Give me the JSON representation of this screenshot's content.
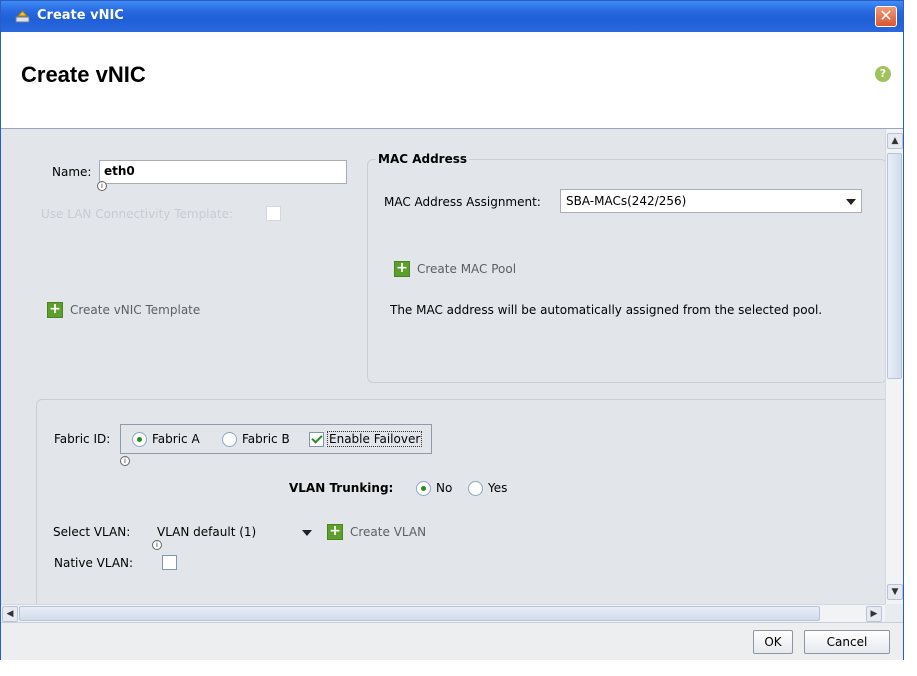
{
  "window": {
    "title": "Create vNIC"
  },
  "header": {
    "title": "Create vNIC",
    "help_symbol": "?"
  },
  "left": {
    "name_label": "Name:",
    "name_value": "eth0",
    "lan_template_label": "Use LAN Connectivity Template:",
    "create_vnic_template": "Create vNIC Template"
  },
  "mac": {
    "group_title": "MAC Address",
    "assignment_label": "MAC Address Assignment:",
    "assignment_value": "SBA-MACs(242/256)",
    "create_pool": "Create MAC Pool",
    "note": "The MAC address will be automatically assigned from the selected pool."
  },
  "fabric": {
    "label": "Fabric ID:",
    "option_a": "Fabric A",
    "option_b": "Fabric B",
    "failover": "Enable Failover",
    "selected": "Fabric A",
    "failover_checked": true
  },
  "vlan": {
    "trunking_label": "VLAN Trunking:",
    "trunk_no": "No",
    "trunk_yes": "Yes",
    "trunk_selected": "No",
    "select_label": "Select VLAN:",
    "select_value": "VLAN default (1)",
    "create_vlan": "Create VLAN",
    "native_label": "Native VLAN:"
  },
  "footer": {
    "ok": "OK",
    "cancel": "Cancel"
  },
  "icons": {
    "close": "close-icon",
    "help": "help-icon",
    "add": "plus-icon",
    "dropdown": "chevron-down-icon"
  },
  "colors": {
    "titlebar": "#2767e0",
    "add_icon": "#5e9e2c",
    "help_icon": "#9fc35a",
    "close_button": "#d9582e"
  }
}
